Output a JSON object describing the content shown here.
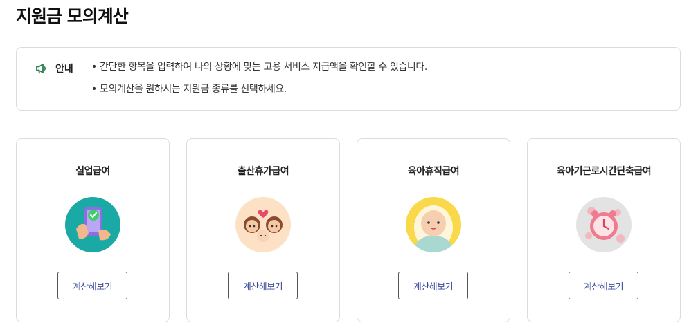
{
  "page": {
    "title": "지원금 모의계산"
  },
  "notice": {
    "label": "안내",
    "items": [
      "간단한 항목을 입력하여 나의 상황에 맞는 고용 서비스 지급액을 확인할 수 있습니다.",
      "모의계산을 원하시는 지원금 종류를 선택하세요."
    ],
    "icon": "megaphone-icon",
    "icon_color": "#2e7d4f"
  },
  "cards": [
    {
      "title": "실업급여",
      "button": "계산해보기",
      "icon": "phone-check-illustration",
      "bg": "#1aa9a5"
    },
    {
      "title": "출산휴가급여",
      "button": "계산해보기",
      "icon": "family-illustration",
      "bg": "#fde1c4"
    },
    {
      "title": "육아휴직급여",
      "button": "계산해보기",
      "icon": "baby-illustration",
      "bg": "#f9d84a"
    },
    {
      "title": "육아기근로시간단축급여",
      "button": "계산해보기",
      "icon": "alarm-clock-illustration",
      "bg": "#e3e3e3"
    }
  ],
  "colors": {
    "button_text": "#3b4a9a",
    "border": "#dcdcdc"
  }
}
